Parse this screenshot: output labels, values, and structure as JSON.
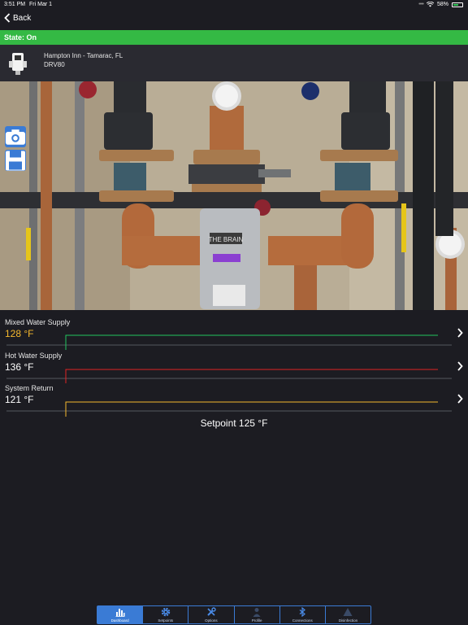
{
  "status_bar": {
    "time": "3:51 PM",
    "date": "Fri Mar 1",
    "battery": "58%",
    "battery_level": 0.58
  },
  "nav": {
    "back_label": "Back"
  },
  "state": {
    "text": "State: On",
    "color": "#34b944"
  },
  "device": {
    "name": "Hampton Inn - Tamarac, FL",
    "model": "DRV80"
  },
  "photo": {
    "plate_text": "THE BRAIN"
  },
  "readings": [
    {
      "label": "Mixed Water Supply",
      "value": "128 °F",
      "value_color": "#f5b82e",
      "line_color": "#22c55e"
    },
    {
      "label": "Hot Water Supply",
      "value": "136 °F",
      "value_color": "#ffffff",
      "line_color": "#e02424"
    },
    {
      "label": "System Return",
      "value": "121 °F",
      "value_color": "#ffffff",
      "line_color": "#f5b82e"
    }
  ],
  "setpoint": "Setpoint 125 °F",
  "tabs": [
    {
      "label": "Dashboard",
      "icon": "bar-chart-icon",
      "active": true
    },
    {
      "label": "Setpoints",
      "icon": "gear-icon",
      "active": false
    },
    {
      "label": "Options",
      "icon": "tools-icon",
      "active": false
    },
    {
      "label": "Profile",
      "icon": "person-icon",
      "active": false
    },
    {
      "label": "Connections",
      "icon": "bluetooth-icon",
      "active": false
    },
    {
      "label": "Disinfection",
      "icon": "warning-icon",
      "active": false
    }
  ],
  "colors": {
    "accent": "#3a7bd5",
    "background": "#1c1c22"
  }
}
